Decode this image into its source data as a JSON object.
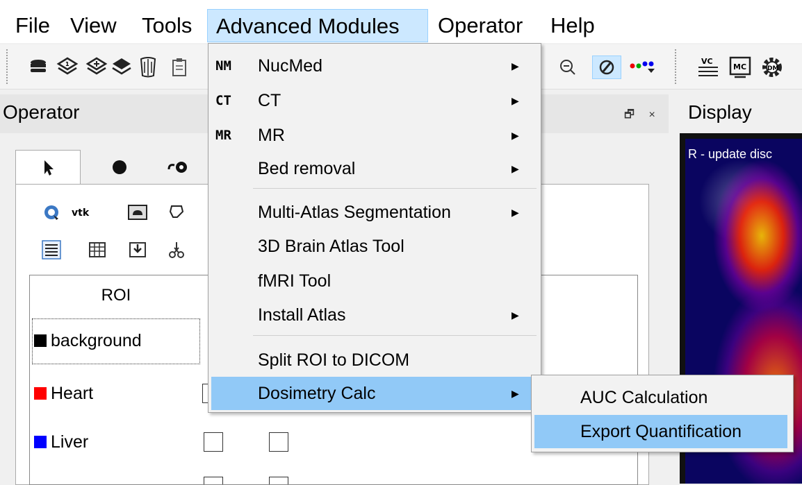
{
  "menubar": {
    "items": [
      "File",
      "View",
      "Tools",
      "Advanced Modules",
      "Operator",
      "Help"
    ],
    "active": "Advanced Modules"
  },
  "toolbar": {
    "icons": [
      "database-icon",
      "layer-1-icon",
      "layer-add-icon",
      "skeleton-icon",
      "clipboard-icon",
      "zoom-out-icon",
      "roi-draw-icon",
      "color-dots-icon",
      "vc-icon",
      "mc-icon",
      "dm-gear-icon"
    ],
    "vc_label": "VC",
    "mc_label": "MC",
    "dm_label": "DM"
  },
  "operator": {
    "title": "Operator",
    "controls": "🗗 ×",
    "tools_row1": [
      "vtk"
    ],
    "table": {
      "header": "ROI",
      "rows": [
        {
          "name": "background",
          "color": "#000000"
        },
        {
          "name": "Heart",
          "color": "#ff0000"
        },
        {
          "name": "Liver",
          "color": "#0000ff"
        }
      ]
    }
  },
  "display": {
    "title": "Display",
    "overlay_text": "R - update disc"
  },
  "advanced_menu": {
    "items": [
      {
        "prefix": "NM",
        "label": "NucMed",
        "submenu": true
      },
      {
        "prefix": "CT",
        "label": "CT",
        "submenu": true
      },
      {
        "prefix": "MR",
        "label": "MR",
        "submenu": true
      },
      {
        "prefix": "",
        "label": "Bed removal",
        "submenu": true
      },
      {
        "prefix": "",
        "label": "Multi-Atlas Segmentation",
        "submenu": true
      },
      {
        "prefix": "",
        "label": "3D Brain Atlas Tool",
        "submenu": false
      },
      {
        "prefix": "",
        "label": "fMRI Tool",
        "submenu": false
      },
      {
        "prefix": "",
        "label": "Install Atlas",
        "submenu": true
      },
      {
        "prefix": "",
        "label": "Split ROI to DICOM",
        "submenu": false
      },
      {
        "prefix": "",
        "label": "Dosimetry Calc",
        "submenu": true
      }
    ],
    "highlighted": "Dosimetry Calc",
    "arrow": "▶"
  },
  "dosimetry_submenu": {
    "items": [
      "AUC Calculation",
      "Export Quantification"
    ],
    "highlighted": "Export Quantification"
  },
  "colors": {
    "menu_highlight": "#91c9f7",
    "menubar_active": "#cce8ff"
  }
}
